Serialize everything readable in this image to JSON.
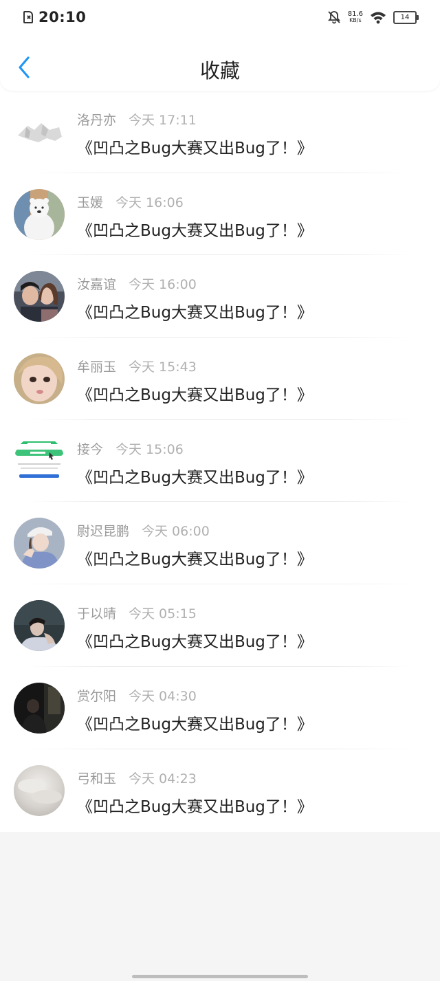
{
  "status_bar": {
    "time": "20:10",
    "net_speed_value": "81.6",
    "net_speed_unit": "KB/s",
    "battery": "14",
    "icons": [
      "sim-error-icon",
      "mute-bell-icon",
      "wifi-icon",
      "battery-icon"
    ]
  },
  "header": {
    "title": "收藏",
    "back_icon": "chevron-left-icon"
  },
  "colors": {
    "accent": "#2196f3",
    "name_gray": "#9a9a9a",
    "time_gray": "#b0b0b0",
    "text": "#222222",
    "page_bg": "#f6f5f5"
  },
  "favorites": [
    {
      "name": "洛丹亦",
      "time": "今天 17:11",
      "message": "《凹凸之Bug大赛又出Bug了！》",
      "avatar": "sketch-photo"
    },
    {
      "name": "玉媛",
      "time": "今天 16:06",
      "message": "《凹凸之Bug大赛又出Bug了！》",
      "avatar": "white-bear"
    },
    {
      "name": "汝嘉谊",
      "time": "今天 16:00",
      "message": "《凹凸之Bug大赛又出Bug了！》",
      "avatar": "couple-photo"
    },
    {
      "name": "牟丽玉",
      "time": "今天 15:43",
      "message": "《凹凸之Bug大赛又出Bug了！》",
      "avatar": "girl-face"
    },
    {
      "name": "接今",
      "time": "今天 15:06",
      "message": "《凹凸之Bug大赛又出Bug了！》",
      "avatar": "app-screenshot"
    },
    {
      "name": "尉迟昆鹏",
      "time": "今天 06:00",
      "message": "《凹凸之Bug大赛又出Bug了！》",
      "avatar": "girl-cap"
    },
    {
      "name": "于以晴",
      "time": "今天 05:15",
      "message": "《凹凸之Bug大赛又出Bug了！》",
      "avatar": "boy-dark"
    },
    {
      "name": "赏尔阳",
      "time": "今天 04:30",
      "message": "《凹凸之Bug大赛又出Bug了！》",
      "avatar": "dark-scene"
    },
    {
      "name": "弓和玉",
      "time": "今天 04:23",
      "message": "《凹凸之Bug大赛又出Bug了！》",
      "avatar": "cloud-photo"
    }
  ]
}
